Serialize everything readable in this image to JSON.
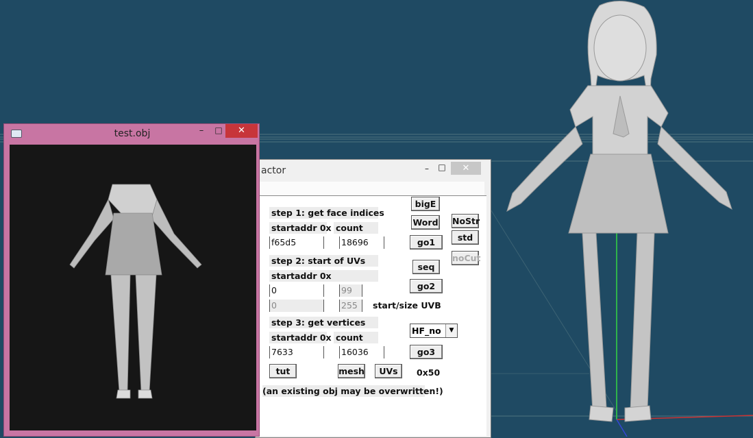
{
  "viewport": {
    "background": "#1f4a63"
  },
  "extractor": {
    "title": "actor",
    "minimize": "–",
    "maximize": "□",
    "close": "✕",
    "step1_label": "step 1: get face indices",
    "startaddr_label": "startaddr 0x",
    "count_label": "count",
    "face_start": "f65d5",
    "face_count": "18696",
    "step2_label": "step 2: start of UVs",
    "uv_start": "0",
    "uv_field2": "99",
    "uvb_start": "0",
    "uvb_size": "255",
    "uvb_label": "start/size UVB",
    "step3_label": "step 3: get vertices",
    "vert_start": "7633",
    "vert_count": "16036",
    "btn_bigE": "bigE",
    "btn_word": "Word",
    "btn_nostr": "NoStr",
    "btn_std": "std",
    "btn_go1": "go1",
    "btn_nocut": "noCut",
    "btn_seq": "seq",
    "btn_go2": "go2",
    "select_value": "HF_no",
    "btn_go3": "go3",
    "btn_tut": "tut",
    "btn_mesh": "mesh",
    "btn_uvs": "UVs",
    "hex_value": "0x50",
    "warning": "(an existing obj may be overwritten!)"
  },
  "objwin": {
    "title": "test.obj",
    "minimize": "–",
    "maximize": "□",
    "close": "✕",
    "frame_color": "#c875a3",
    "close_color": "#c7353a"
  }
}
